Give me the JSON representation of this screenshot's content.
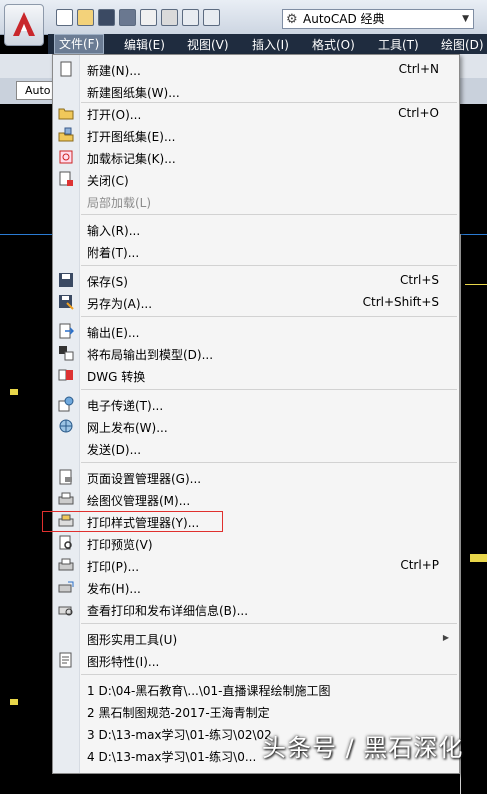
{
  "workspace": {
    "value": "AutoCAD 经典"
  },
  "menubar": {
    "items": [
      "文件(F)",
      "编辑(E)",
      "视图(V)",
      "插入(I)",
      "格式(O)",
      "工具(T)",
      "绘图(D)"
    ]
  },
  "toolbar3": {
    "tab_label": "Auto"
  },
  "file_menu": {
    "new": {
      "label": "新建(N)...",
      "shortcut": "Ctrl+N"
    },
    "new_sheet_set": {
      "label": "新建图纸集(W)..."
    },
    "open": {
      "label": "打开(O)...",
      "shortcut": "Ctrl+O"
    },
    "open_sheet_set": {
      "label": "打开图纸集(E)..."
    },
    "load_markup": {
      "label": "加载标记集(K)..."
    },
    "close": {
      "label": "关闭(C)"
    },
    "partial_load": {
      "label": "局部加载(L)"
    },
    "import": {
      "label": "输入(R)..."
    },
    "attach": {
      "label": "附着(T)..."
    },
    "save": {
      "label": "保存(S)",
      "shortcut": "Ctrl+S"
    },
    "save_as": {
      "label": "另存为(A)...",
      "shortcut": "Ctrl+Shift+S"
    },
    "export": {
      "label": "输出(E)..."
    },
    "export_layout": {
      "label": "将布局输出到模型(D)..."
    },
    "dwg_convert": {
      "label": "DWG 转换"
    },
    "etransmit": {
      "label": "电子传递(T)..."
    },
    "publish_web": {
      "label": "网上发布(W)..."
    },
    "send": {
      "label": "发送(D)..."
    },
    "page_setup": {
      "label": "页面设置管理器(G)..."
    },
    "plotter_manager": {
      "label": "绘图仪管理器(M)..."
    },
    "plot_style_manager": {
      "label": "打印样式管理器(Y)..."
    },
    "plot_preview": {
      "label": "打印预览(V)"
    },
    "plot": {
      "label": "打印(P)...",
      "shortcut": "Ctrl+P"
    },
    "publish": {
      "label": "发布(H)..."
    },
    "view_plot_details": {
      "label": "查看打印和发布详细信息(B)..."
    },
    "drawing_utilities": {
      "label": "图形实用工具(U)"
    },
    "drawing_properties": {
      "label": "图形特性(I)..."
    },
    "recent": [
      "1 D:\\04-黑石教育\\...\\01-直播课程绘制施工图",
      "2 黑石制图规范-2017-王海青制定",
      "3 D:\\13-max学习\\01-练习\\02\\02",
      "4 D:\\13-max学习\\01-练习\\0..."
    ]
  },
  "watermark": {
    "text": "头条号 / 黑石深化"
  },
  "colors": {
    "highlight": "#e0302e",
    "menubar": "#1f2c3f"
  }
}
